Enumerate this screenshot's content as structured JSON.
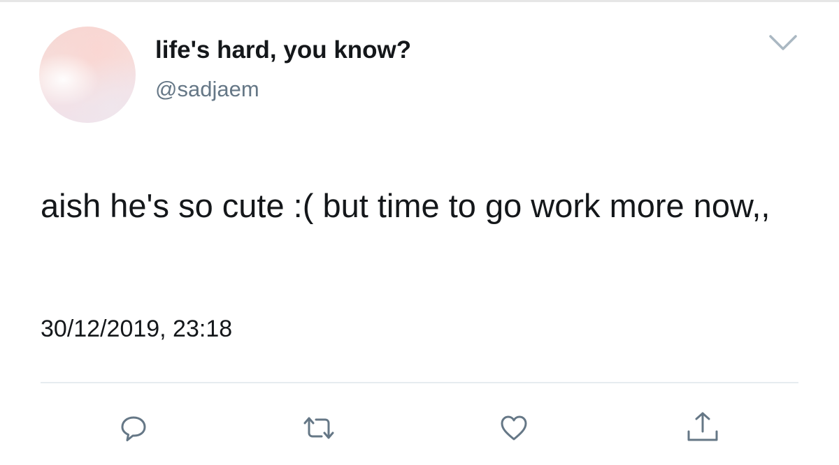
{
  "tweet": {
    "display_name": "life's hard, you know?",
    "handle": "@sadjaem",
    "text": "aish he's so cute :( but time to go work more now,,",
    "timestamp": "30/12/2019, 23:18"
  },
  "icons": {
    "menu": "chevron-down-icon",
    "reply": "reply-icon",
    "retweet": "retweet-icon",
    "like": "heart-icon",
    "share": "share-icon"
  },
  "colors": {
    "text": "#14171a",
    "secondary": "#657786",
    "icon": "#657786",
    "divider": "#e6ecf0"
  }
}
